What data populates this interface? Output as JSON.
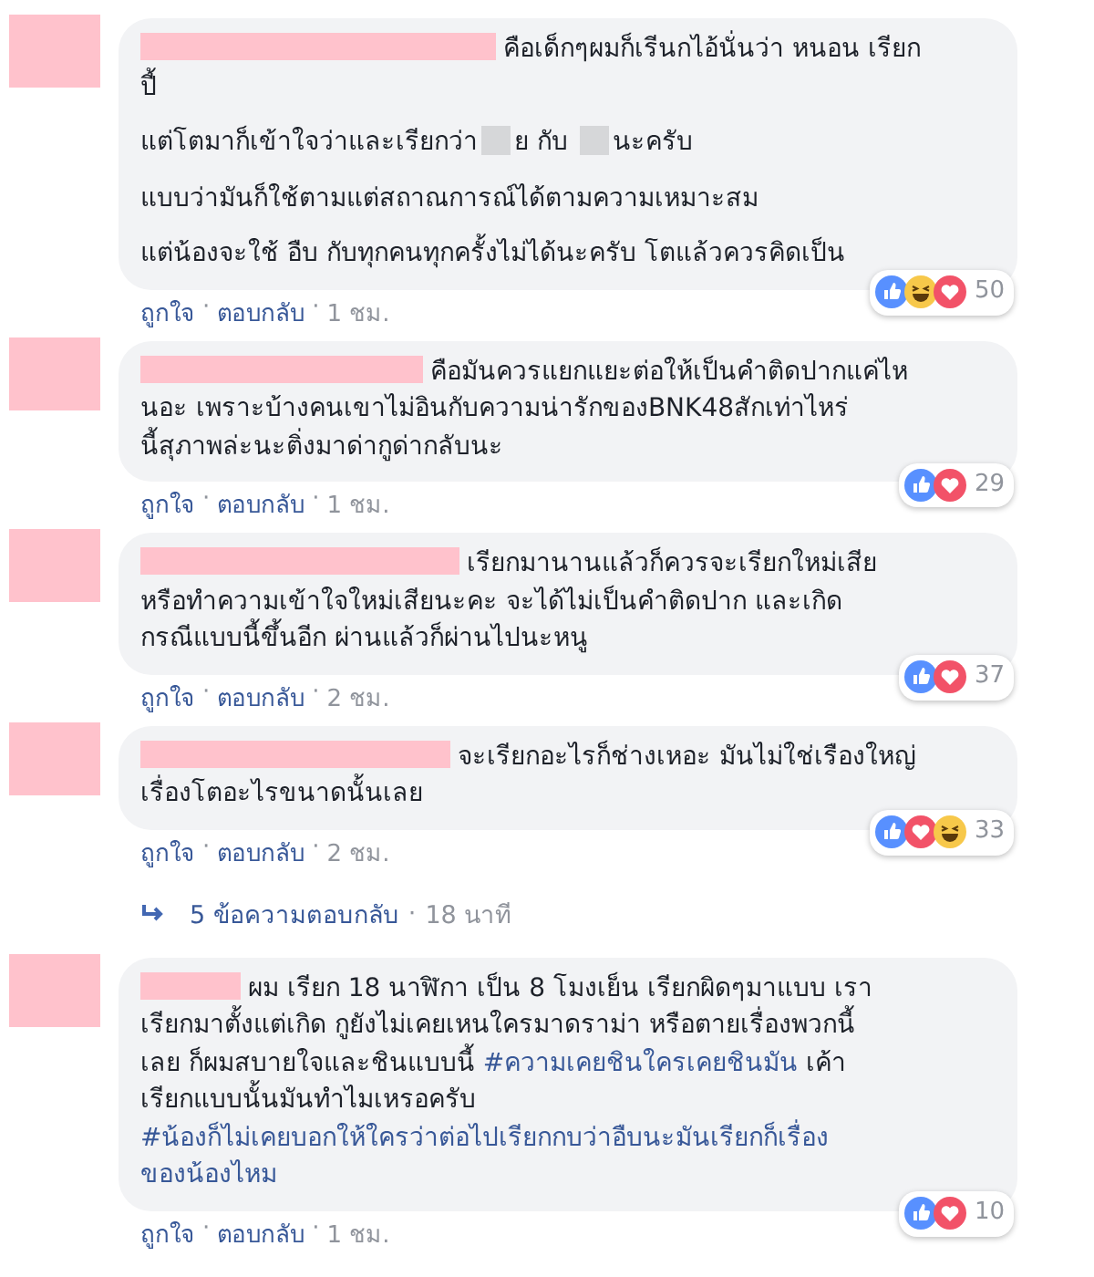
{
  "comments": [
    {
      "paragraphs": [
        [
          [
            {
              "kind": "name"
            },
            {
              "kind": "text",
              "text": "คือเด็กๆผมก็เรีนกไอ้นั่นว่า หนอน เรียก"
            }
          ],
          [
            {
              "kind": "text",
              "text": "ปี้"
            }
          ]
        ],
        [
          [
            {
              "kind": "text",
              "text": "แต่โตมาก็เข้าใจว่าและเรียกว่า"
            },
            {
              "kind": "redaction"
            },
            {
              "kind": "text",
              "text": "ย กับ "
            },
            {
              "kind": "redaction"
            },
            {
              "kind": "text",
              "text": "นะครับ"
            }
          ]
        ],
        [
          [
            {
              "kind": "text",
              "text": "แบบว่ามันก็ใช้ตามแต่สถาณการณ์ได้ตามความเหมาะสม"
            }
          ]
        ],
        [
          [
            {
              "kind": "text",
              "text": "แต่น้องจะใช้ อืบ กับทุกคนทุกครั้งไม่ได้นะครับ โตแล้วควรคิดเป็น"
            }
          ]
        ]
      ],
      "reactions": [
        {
          "kind": "like"
        },
        {
          "kind": "haha"
        },
        {
          "kind": "love"
        }
      ],
      "count": "50",
      "actions": [
        {
          "label": "ถูกใจ",
          "sep": "·"
        },
        {
          "label": "ตอบกลับ",
          "sep": "·"
        }
      ],
      "time": "1 ชม."
    },
    {
      "paragraphs": [
        [
          [
            {
              "kind": "name"
            },
            {
              "kind": "text",
              "text": "คือมันควรแยกแยะต่อให้เป็นคำติดปากแค่ไห"
            }
          ],
          [
            {
              "kind": "text",
              "text": "นอะ เพราะบ้างคนเขาไม่อินกับความน่ารักของBNK48สักเท่าไหร่"
            }
          ],
          [
            {
              "kind": "text",
              "text": "นี้สุภาพล่ะนะติ่งมาด่ากูด่ากลับนะ"
            }
          ]
        ]
      ],
      "reactions": [
        {
          "kind": "like"
        },
        {
          "kind": "love"
        }
      ],
      "count": "29",
      "actions": [
        {
          "label": "ถูกใจ",
          "sep": "·"
        },
        {
          "label": "ตอบกลับ",
          "sep": "·"
        }
      ],
      "time": "1 ชม."
    },
    {
      "paragraphs": [
        [
          [
            {
              "kind": "name"
            },
            {
              "kind": "text",
              "text": "เรียกมานานแล้วก็ควรจะเรียกใหม่เสีย"
            }
          ],
          [
            {
              "kind": "text",
              "text": "หรือทำความเข้าใจใหม่เสียนะคะ จะได้ไม่เป็นคำติดปาก และเกิด"
            }
          ],
          [
            {
              "kind": "text",
              "text": "กรณีแบบนี้ขึ้นอีก ผ่านแล้วก็ผ่านไปนะหนู"
            }
          ]
        ]
      ],
      "reactions": [
        {
          "kind": "like"
        },
        {
          "kind": "love"
        }
      ],
      "count": "37",
      "actions": [
        {
          "label": "ถูกใจ",
          "sep": "·"
        },
        {
          "label": "ตอบกลับ",
          "sep": "·"
        }
      ],
      "time": "2 ชม."
    },
    {
      "paragraphs": [
        [
          [
            {
              "kind": "name"
            },
            {
              "kind": "text",
              "text": "จะเรียกอะไรก็ช่างเหอะ มันไม่ใช่เรืองใหญ่"
            }
          ],
          [
            {
              "kind": "text",
              "text": "เรื่องโตอะไรขนาดนั้นเลย"
            }
          ]
        ]
      ],
      "reactions": [
        {
          "kind": "like"
        },
        {
          "kind": "love"
        },
        {
          "kind": "haha"
        }
      ],
      "count": "33",
      "actions": [
        {
          "label": "ถูกใจ",
          "sep": "·"
        },
        {
          "label": "ตอบกลับ",
          "sep": "·"
        }
      ],
      "time": "2 ชม.",
      "replies": {
        "label": "5 ข้อความตอบกลับ",
        "sep": "·",
        "time": "18 นาที"
      }
    },
    {
      "paragraphs": [
        [
          [
            {
              "kind": "name"
            },
            {
              "kind": "text",
              "text": "ผม เรียก 18 นาฬิกา เป็น 8 โมงเย็น เรียกผิดๆมาแบบ เรา"
            }
          ],
          [
            {
              "kind": "text",
              "text": "เรียกมาตั้งแต่เกิด กูยังไม่เคยเหนใครมาดราม่า หรือตายเรื่องพวกนี้"
            }
          ],
          [
            {
              "kind": "text",
              "text": "เลย ก็ผมสบายใจและชินแบบนี้ "
            },
            {
              "kind": "hashtag",
              "text": "#ความเคยชินใครเคยชินมัน"
            },
            {
              "kind": "text",
              "text": " เค้า"
            }
          ],
          [
            {
              "kind": "text",
              "text": "เรียกแบบนั้นมันทำไมเหรอครับ"
            }
          ],
          [
            {
              "kind": "hashtag",
              "text": "#น้องก็ไม่เคยบอกให้ใครว่าต่อไปเรียกกบว่าอืบนะมันเรียกก็เรื่อง"
            }
          ],
          [
            {
              "kind": "hashtag",
              "text": "ของน้องไหม"
            }
          ]
        ]
      ],
      "reactions": [
        {
          "kind": "like"
        },
        {
          "kind": "love"
        }
      ],
      "count": "10",
      "actions": [
        {
          "label": "ถูกใจ",
          "sep": "·"
        },
        {
          "label": "ตอบกลับ",
          "sep": "·"
        }
      ],
      "time": "1 ชม."
    }
  ]
}
